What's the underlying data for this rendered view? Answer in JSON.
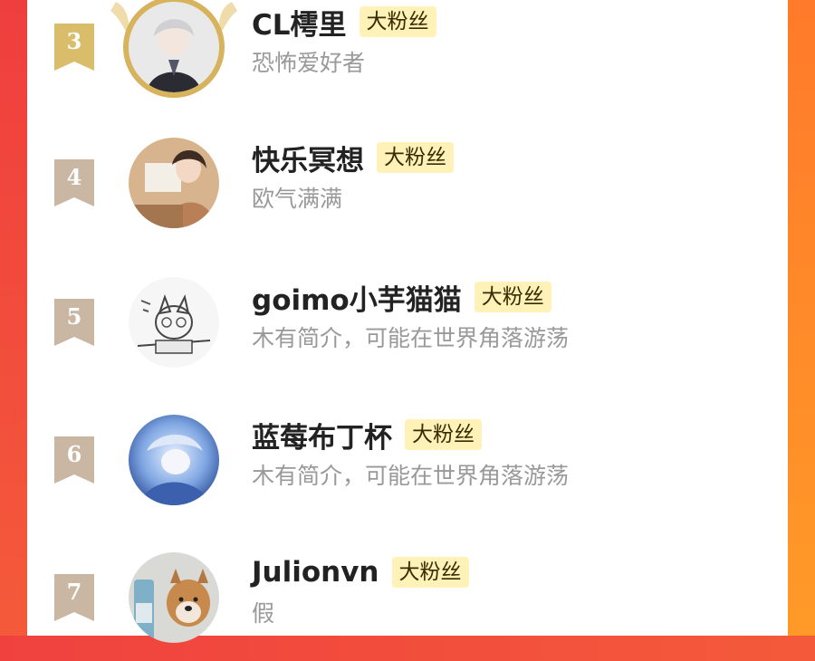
{
  "colors": {
    "badge_bg": "#fff2b8",
    "rank_ribbon": "#c9b6a3",
    "rank_ribbon_gold": "#d9bd6a",
    "accent_left": "#f0413f",
    "accent_right": "#ff8a2a"
  },
  "fans": [
    {
      "rank": "3",
      "name": "CL樗里",
      "badge": "大粉丝",
      "bio": "恐怖爱好者",
      "icon": "gold-laurel-icon"
    },
    {
      "rank": "4",
      "name": "快乐冥想",
      "badge": "大粉丝",
      "bio": "欧气满满",
      "icon": "rank-ribbon-icon"
    },
    {
      "rank": "5",
      "name": "goimo小芋猫猫",
      "badge": "大粉丝",
      "bio": "木有简介，可能在世界角落游荡",
      "icon": "rank-ribbon-icon"
    },
    {
      "rank": "6",
      "name": "蓝莓布丁杯",
      "badge": "大粉丝",
      "bio": "木有简介，可能在世界角落游荡",
      "icon": "rank-ribbon-icon"
    },
    {
      "rank": "7",
      "name": "Julionvn",
      "badge": "大粉丝",
      "bio": "假",
      "icon": "rank-ribbon-icon"
    }
  ]
}
